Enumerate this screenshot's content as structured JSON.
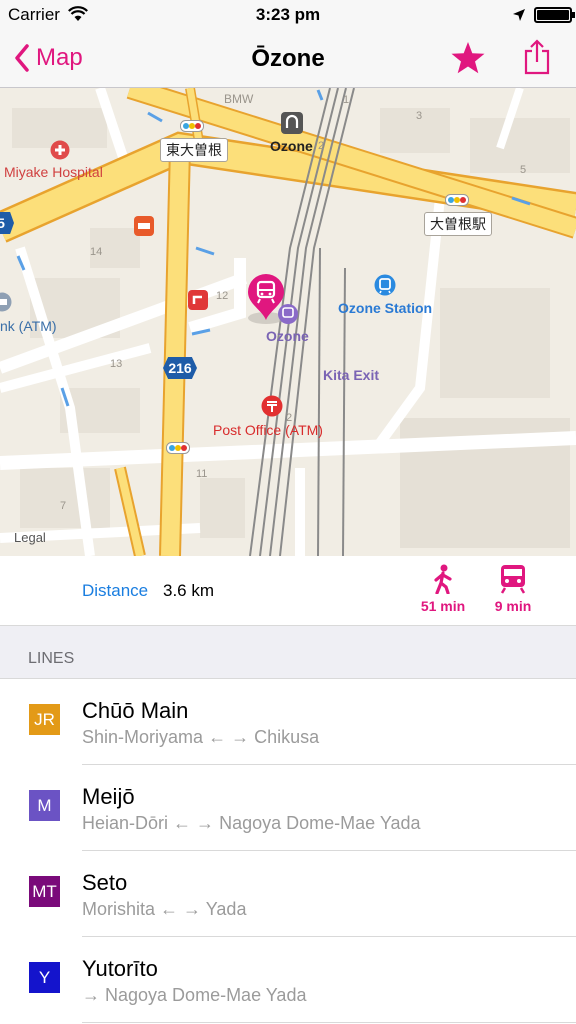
{
  "status": {
    "carrier": "Carrier",
    "time": "3:23 pm",
    "battery_percent": 100
  },
  "nav": {
    "back_label": "Map",
    "title": "Ōzone",
    "accent_color": "#e0177f",
    "back_icon": "chevron-left-icon",
    "favorite_icon": "star-icon",
    "share_icon": "share-icon"
  },
  "map": {
    "labels": {
      "hospital": "Miyake Hospital",
      "ozone_top": "Ozone",
      "ozone_station_label": "Ozone",
      "ozone_station": "Ozone Station",
      "atm": "nk (ATM)",
      "kita_exit": "Kita Exit",
      "post_office": "Post Office (ATM)",
      "bmw": "BMW",
      "higashi_ozone": "東大曽根",
      "ozone_eki": "大曽根駅",
      "route_216": "216",
      "route_5": "5",
      "legal": "Legal"
    },
    "block_numbers": [
      "1",
      "2",
      "3",
      "5",
      "14",
      "12",
      "13",
      "2",
      "11",
      "7"
    ]
  },
  "info": {
    "distance_label": "Distance",
    "distance_value": "3.6 km",
    "walk_time": "51 min",
    "train_time": "9 min",
    "walk_icon": "walking-person-icon",
    "train_icon": "train-icon"
  },
  "section": {
    "title": "LINES"
  },
  "lines": [
    {
      "badge": "JR",
      "color": "#e39a17",
      "name": "Chūō Main",
      "from": "Shin-Moriyama",
      "arrows": "← →",
      "to": "Chikusa"
    },
    {
      "badge": "M",
      "color": "#6b53c4",
      "name": "Meijō",
      "from": "Heian-Dōri",
      "arrows": "← →",
      "to": "Nagoya Dome-Mae Yada"
    },
    {
      "badge": "MT",
      "color": "#7a0a7a",
      "name": "Seto",
      "from": "Morishita",
      "arrows": "← →",
      "to": "Yada"
    },
    {
      "badge": "Y",
      "color": "#1414cc",
      "name": "Yutorīto",
      "from": "",
      "arrows": "→",
      "to": "Nagoya Dome-Mae Yada"
    }
  ]
}
